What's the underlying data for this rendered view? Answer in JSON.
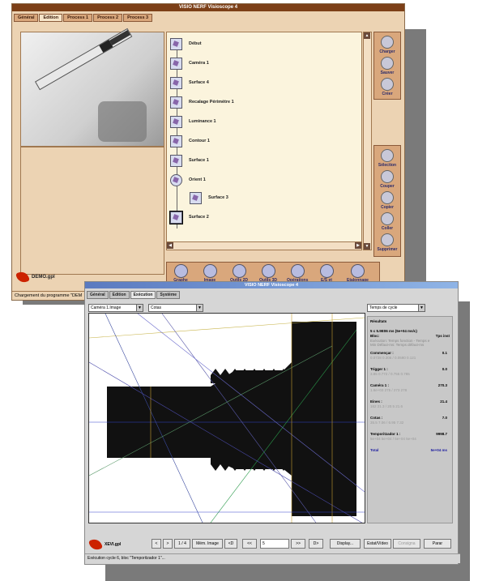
{
  "window1": {
    "title": "VISIO NERF Visioscope 4",
    "tabs": [
      "Général",
      "Edition",
      "Process 1",
      "Process 2",
      "Process 3"
    ],
    "active_tab": "Edition",
    "flow_items": [
      "Début",
      "Caméra 1",
      "Surface 4",
      "Recalage Périmètre 1",
      "Luminance 1",
      "Contour 1",
      "Surface 1",
      "Orient 1",
      "Surface 3",
      "Surface 2"
    ],
    "right_buttons_top": [
      "Charger",
      "Sauver",
      "Créer"
    ],
    "right_buttons_bottom": [
      "Sélection",
      "Couper",
      "Copier",
      "Coller",
      "Supprimer"
    ],
    "bottom_buttons": [
      "Graphe",
      "Image",
      "Outils 2D",
      "Outils 3D",
      "Opérations",
      "E/S et COM",
      "Etalonnage"
    ],
    "logo_text": "DEMO.gpl",
    "status": "Chargement du programme \"DEM"
  },
  "window2": {
    "title": "VISIO NERF Visioscope 4",
    "tabs": [
      "Général",
      "Edition",
      "Exécution",
      "Système"
    ],
    "active_tab": "Exécution",
    "camera_select": "Caméra 1.Image",
    "cotas_select": "Cotas",
    "cycle_select": "Temps de cycle",
    "results": {
      "header": "Résultats",
      "summary": "5 c 5.9E06 ms (5e+04 ms/c)",
      "col_bloc": "Bloc:",
      "col_tps": "Tps inst",
      "legend": "Exécution: Temps fonction - Temps e",
      "legend2": "Min Défaut-ms: Temps défaut-ms",
      "rows": [
        {
          "name": "Commençar :",
          "value": "0.1",
          "sub": "0.0728   0.306 / 0.0590   0.121"
        },
        {
          "name": "Trigger 1 :",
          "value": "0.0",
          "sub": "3.85   0.772 / 0.755   0.785"
        },
        {
          "name": "Caméra 1 :",
          "value": "270.3",
          "sub": "1.6e+03   275 / 273   278"
        },
        {
          "name": "Eines :",
          "value": "21.4",
          "sub": "162   21.3 / 20.5   21.6"
        },
        {
          "name": "Cotas :",
          "value": "7.0",
          "sub": "35.5   7.06 / 6.95   7.32"
        },
        {
          "name": "Temporitzador 1 :",
          "value": "9998.7",
          "sub": "5e+04   5e+04 / 5e+04   5e+04"
        },
        {
          "name": "Total",
          "value": "5e+04 ms"
        }
      ]
    },
    "controls": [
      "<",
      ">",
      "1 / 4",
      "Mém. Image",
      "<D",
      "<<",
      "5",
      ">>",
      "D>",
      "Display...",
      "Estat/Vídeo",
      "Consigna",
      "Parar"
    ],
    "logo_text": "XEVI.gpl",
    "status": "Exécution cycle 6, bloc \"Temporitzador 1\"...",
    "accent": "#1a1aa0"
  }
}
